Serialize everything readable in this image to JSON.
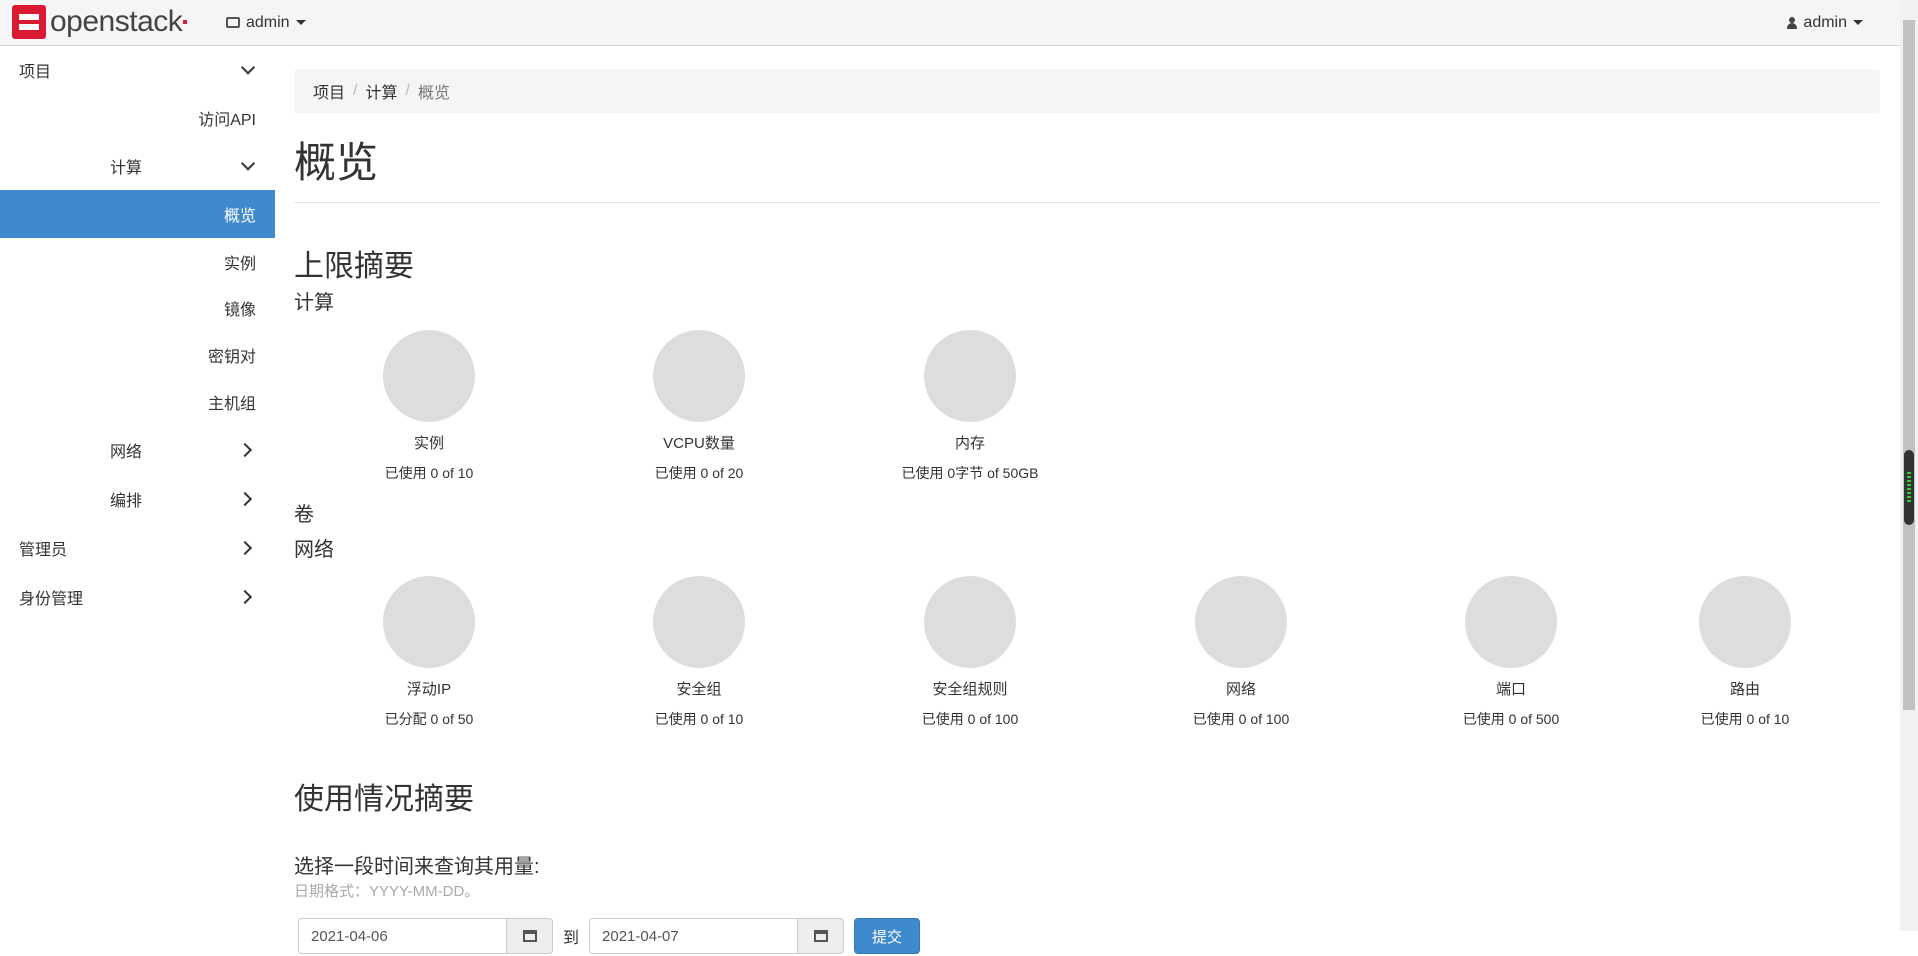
{
  "navbar": {
    "brand": "openstack",
    "project_menu": "admin",
    "user_menu": "admin"
  },
  "sidebar": {
    "project": "项目",
    "api_access": "访问API",
    "compute": "计算",
    "overview": "概览",
    "instances": "实例",
    "images": "镜像",
    "keypairs": "密钥对",
    "server_groups": "主机组",
    "network": "网络",
    "orchestration": "编排",
    "admin": "管理员",
    "identity": "身份管理"
  },
  "breadcrumb": [
    "项目",
    "计算",
    "概览"
  ],
  "page_title": "概览",
  "limit_summary": {
    "heading": "上限摘要",
    "compute_heading": "计算",
    "compute": [
      {
        "label": "实例",
        "usage": "已使用 0 of 10",
        "used": 0,
        "total": 10
      },
      {
        "label": "VCPU数量",
        "usage": "已使用 0 of 20",
        "used": 0,
        "total": 20
      },
      {
        "label": "内存",
        "usage": "已使用 0字节 of 50GB",
        "used": 0,
        "total": 50
      }
    ],
    "volume_heading": "卷",
    "network_heading": "网络",
    "network": [
      {
        "label": "浮动IP",
        "usage": "已分配 0 of 50",
        "used": 0,
        "total": 50
      },
      {
        "label": "安全组",
        "usage": "已使用 0 of 10",
        "used": 0,
        "total": 10
      },
      {
        "label": "安全组规则",
        "usage": "已使用 0 of 100",
        "used": 0,
        "total": 100
      },
      {
        "label": "网络",
        "usage": "已使用 0 of 100",
        "used": 0,
        "total": 100
      },
      {
        "label": "端口",
        "usage": "已使用 0 of 500",
        "used": 0,
        "total": 500
      },
      {
        "label": "路由",
        "usage": "已使用 0 of 10",
        "used": 0,
        "total": 10
      }
    ]
  },
  "usage_summary": {
    "heading": "使用情况摘要",
    "query_title": "选择一段时间来查询其用量:",
    "date_hint": "日期格式：YYYY-MM-DD。",
    "start_date": "2021-04-06",
    "to_label": "到",
    "end_date": "2021-04-07",
    "submit": "提交"
  },
  "colors": {
    "accent": "#3f8acd",
    "brand": "#da1a32",
    "pie_empty": "#dddddd"
  }
}
